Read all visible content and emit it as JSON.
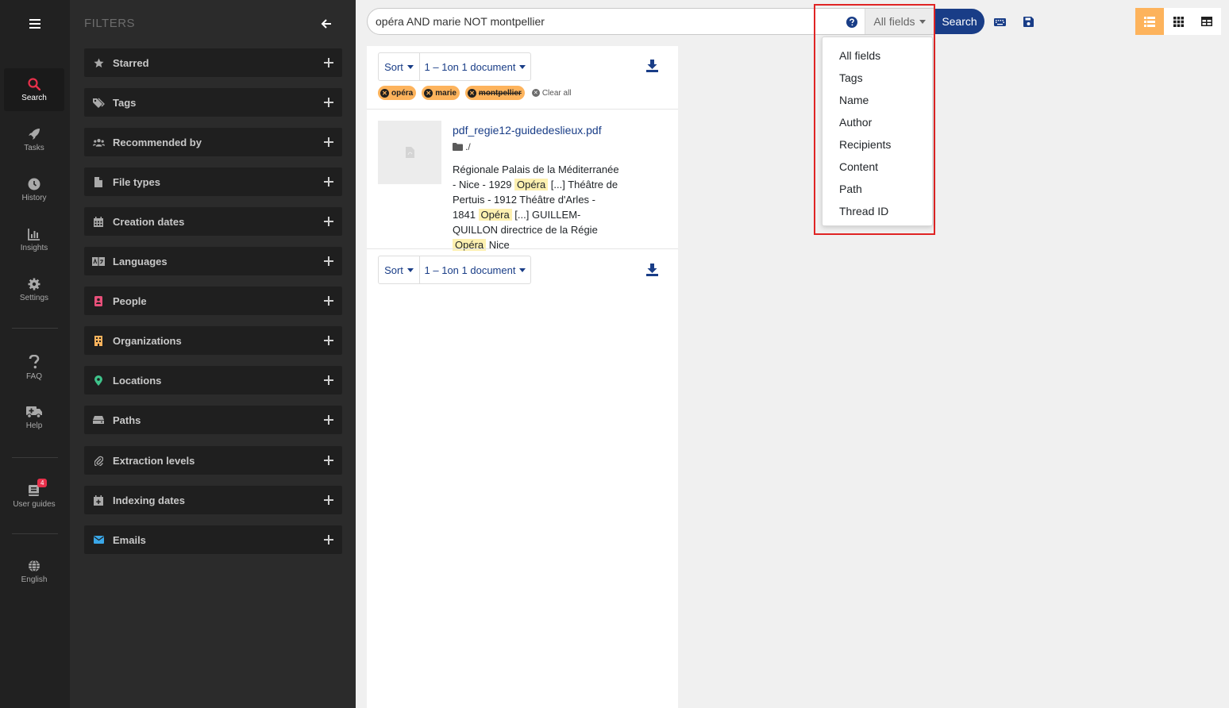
{
  "nav": {
    "items": [
      {
        "label": "Search",
        "icon": "search-icon",
        "active": true
      },
      {
        "label": "Tasks",
        "icon": "rocket-icon"
      },
      {
        "label": "History",
        "icon": "clock-icon"
      },
      {
        "label": "Insights",
        "icon": "chart-icon"
      },
      {
        "label": "Settings",
        "icon": "gear-icon"
      },
      {
        "label": "FAQ",
        "icon": "question-icon"
      },
      {
        "label": "Help",
        "icon": "ambulance-icon"
      },
      {
        "label": "User guides",
        "icon": "book-icon",
        "badge": "4"
      },
      {
        "label": "English",
        "icon": "globe-icon"
      }
    ]
  },
  "filters": {
    "title": "FILTERS",
    "items": [
      {
        "label": "Starred",
        "icon": "star-icon"
      },
      {
        "label": "Tags",
        "icon": "tags-icon"
      },
      {
        "label": "Recommended by",
        "icon": "users-icon"
      },
      {
        "label": "File types",
        "icon": "file-icon"
      },
      {
        "label": "Creation dates",
        "icon": "calendar-icon"
      },
      {
        "label": "Languages",
        "icon": "language-icon"
      },
      {
        "label": "People",
        "icon": "person-icon"
      },
      {
        "label": "Organizations",
        "icon": "building-icon"
      },
      {
        "label": "Locations",
        "icon": "map-pin-icon"
      },
      {
        "label": "Paths",
        "icon": "hdd-icon"
      },
      {
        "label": "Extraction levels",
        "icon": "paperclip-icon"
      },
      {
        "label": "Indexing dates",
        "icon": "calendar-plus-icon"
      },
      {
        "label": "Emails",
        "icon": "envelope-icon"
      }
    ]
  },
  "search": {
    "query": "opéra AND marie NOT montpellier",
    "field": "All fields",
    "button": "Search"
  },
  "field_dropdown": {
    "options": [
      "All fields",
      "Tags",
      "Name",
      "Author",
      "Recipients",
      "Content",
      "Path",
      "Thread ID"
    ]
  },
  "results": {
    "sort_label": "Sort",
    "range_bold": "1 – 1",
    "range_rest": " on 1 document",
    "chips": [
      {
        "label": "opéra",
        "negated": false
      },
      {
        "label": "marie",
        "negated": false
      },
      {
        "label": "montpellier",
        "negated": true
      }
    ],
    "clear_all": "Clear all",
    "document": {
      "title": "pdf_regie12-guidedeslieux.pdf",
      "path": "./",
      "snippet": [
        {
          "t": "Régionale Palais de la Méditerranée - Nice - 1929 "
        },
        {
          "t": "Opéra",
          "hl": true
        },
        {
          "t": " [...] Théâtre de Pertuis - 1912 Théâtre d'Arles - 1841 "
        },
        {
          "t": "Opéra",
          "hl": true
        },
        {
          "t": " [...] GUILLEM-QUILLON directrice de la Régie "
        },
        {
          "t": "Opéra",
          "hl": true
        },
        {
          "t": " Nice"
        }
      ]
    }
  },
  "colors": {
    "accent": "#fdb35c",
    "primary": "#193d87",
    "active_nav_icon": "#e8304b",
    "highlight_box": "#e02424"
  }
}
